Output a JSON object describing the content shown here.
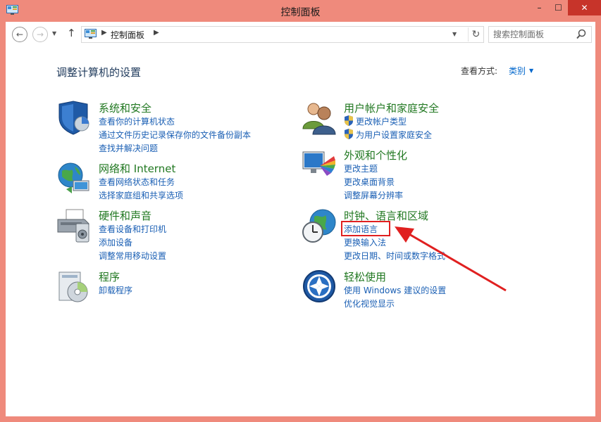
{
  "window": {
    "title": "控制面板",
    "minimize": "–",
    "maximize": "☐",
    "close": "✕"
  },
  "nav": {
    "back": "←",
    "forward": "→",
    "up": "↑",
    "breadcrumb": "控制面板",
    "search_placeholder": "搜索控制面板"
  },
  "header": {
    "title": "调整计算机的设置",
    "view_label": "查看方式:",
    "view_value": "类别"
  },
  "categories": {
    "system": {
      "title": "系统和安全",
      "links": [
        "查看你的计算机状态",
        "通过文件历史记录保存你的文件备份副本",
        "查找并解决问题"
      ]
    },
    "network": {
      "title": "网络和 Internet",
      "links": [
        "查看网络状态和任务",
        "选择家庭组和共享选项"
      ]
    },
    "hardware": {
      "title": "硬件和声音",
      "links": [
        "查看设备和打印机",
        "添加设备",
        "调整常用移动设置"
      ]
    },
    "programs": {
      "title": "程序",
      "links": [
        "卸载程序"
      ]
    },
    "users": {
      "title": "用户帐户和家庭安全",
      "links": [
        "更改帐户类型",
        "为用户设置家庭安全"
      ]
    },
    "appearance": {
      "title": "外观和个性化",
      "links": [
        "更改主题",
        "更改桌面背景",
        "调整屏幕分辨率"
      ]
    },
    "clock": {
      "title": "时钟、语言和区域",
      "links": [
        "添加语言",
        "更换输入法",
        "更改日期、时间或数字格式"
      ]
    },
    "ease": {
      "title": "轻松使用",
      "links": [
        "使用 Windows 建议的设置",
        "优化视觉显示"
      ]
    }
  },
  "colors": {
    "frame": "#ef8a7c",
    "close_button": "#c7342a",
    "category_title": "#217821",
    "link": "#1a5fb4",
    "annotation": "#e02020"
  }
}
